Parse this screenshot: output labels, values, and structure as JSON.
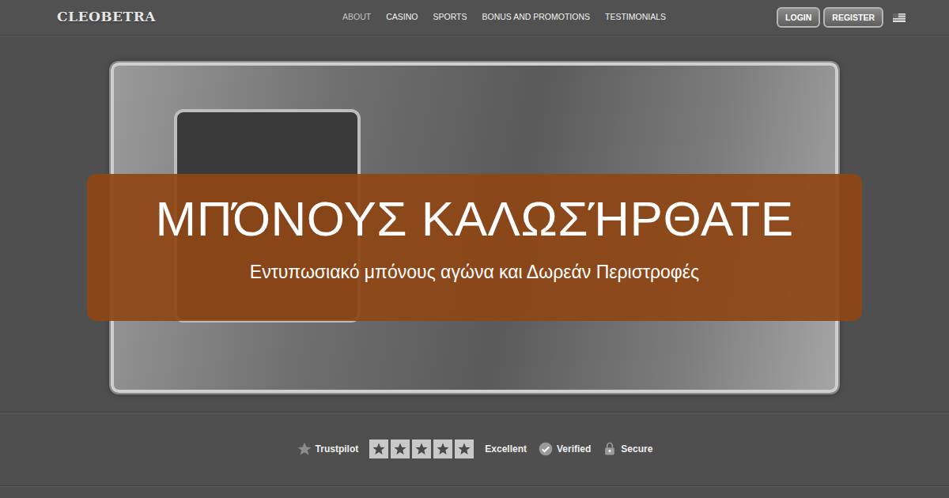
{
  "header": {
    "logo": "CLEOBETRA",
    "nav": [
      {
        "label": "ABOUT",
        "selected": true
      },
      {
        "label": "CASINO",
        "selected": false
      },
      {
        "label": "SPORTS",
        "selected": false
      },
      {
        "label": "BONUS AND PROMOTIONS",
        "selected": false
      },
      {
        "label": "TESTIMONIALS",
        "selected": false
      }
    ],
    "buttons": [
      "LOGIN",
      "REGISTER"
    ]
  },
  "hero": {
    "title": "ΜΠΌΝΟΥΣ ΚΑΛΩΣΉΡΘΑΤΕ",
    "subtitle": "Εντυπωσιακό μπόνους αγώνα και Δωρεάν Περιστροφές"
  },
  "trust": {
    "brand": "Trustpilot",
    "stars": 5,
    "rating": "Excellent",
    "badges": [
      "Verified",
      "Secure"
    ]
  }
}
